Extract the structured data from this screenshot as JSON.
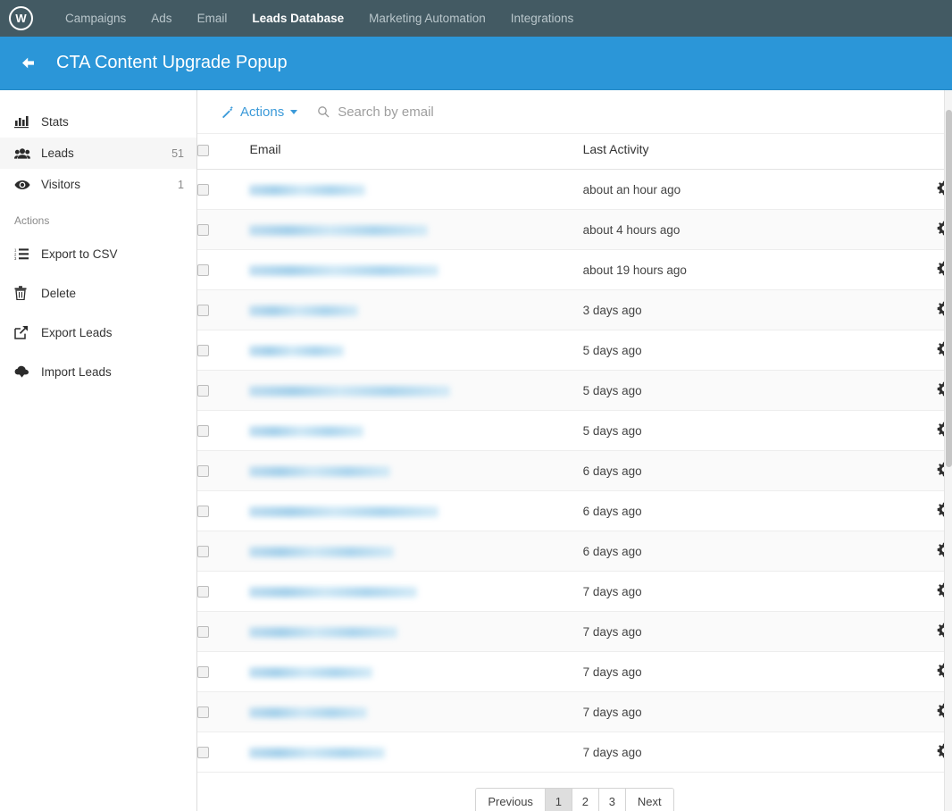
{
  "topnav": {
    "logo_text": "W",
    "items": [
      {
        "label": "Campaigns",
        "active": false
      },
      {
        "label": "Ads",
        "active": false
      },
      {
        "label": "Email",
        "active": false
      },
      {
        "label": "Leads Database",
        "active": true
      },
      {
        "label": "Marketing Automation",
        "active": false
      },
      {
        "label": "Integrations",
        "active": false
      }
    ]
  },
  "header": {
    "back_label": "back",
    "title": "CTA Content Upgrade Popup",
    "bg_color": "#2b96d8"
  },
  "sidebar": {
    "items": [
      {
        "label": "Stats",
        "count": "",
        "icon": "bar-chart-icon",
        "active": false
      },
      {
        "label": "Leads",
        "count": "51",
        "icon": "users-icon",
        "active": true
      },
      {
        "label": "Visitors",
        "count": "1",
        "icon": "eye-icon",
        "active": false
      }
    ],
    "section_label": "Actions",
    "actions": [
      {
        "label": "Export to CSV",
        "icon": "ordered-list-icon"
      },
      {
        "label": "Delete",
        "icon": "trash-icon"
      },
      {
        "label": "Export Leads",
        "icon": "external-link-icon"
      },
      {
        "label": "Import Leads",
        "icon": "cloud-download-icon"
      }
    ]
  },
  "toolbar": {
    "actions_label": "Actions",
    "actions_icon": "magic-wand-icon",
    "search_placeholder": "Search by email",
    "search_value": "",
    "search_icon": "search-icon"
  },
  "table": {
    "columns": [
      "Email",
      "Last Activity"
    ],
    "select_all_checked": false,
    "row_action_icon": "gear-icon",
    "rows": [
      {
        "email_redacted": true,
        "email_width": 130,
        "last_activity": "about an hour ago"
      },
      {
        "email_redacted": true,
        "email_width": 200,
        "last_activity": "about 4 hours ago"
      },
      {
        "email_redacted": true,
        "email_width": 212,
        "last_activity": "about 19 hours ago"
      },
      {
        "email_redacted": true,
        "email_width": 122,
        "last_activity": "3 days ago"
      },
      {
        "email_redacted": true,
        "email_width": 106,
        "last_activity": "5 days ago"
      },
      {
        "email_redacted": true,
        "email_width": 225,
        "last_activity": "5 days ago"
      },
      {
        "email_redacted": true,
        "email_width": 128,
        "last_activity": "5 days ago"
      },
      {
        "email_redacted": true,
        "email_width": 158,
        "last_activity": "6 days ago"
      },
      {
        "email_redacted": true,
        "email_width": 212,
        "last_activity": "6 days ago"
      },
      {
        "email_redacted": true,
        "email_width": 162,
        "last_activity": "6 days ago"
      },
      {
        "email_redacted": true,
        "email_width": 188,
        "last_activity": "7 days ago"
      },
      {
        "email_redacted": true,
        "email_width": 166,
        "last_activity": "7 days ago"
      },
      {
        "email_redacted": true,
        "email_width": 138,
        "last_activity": "7 days ago"
      },
      {
        "email_redacted": true,
        "email_width": 132,
        "last_activity": "7 days ago"
      },
      {
        "email_redacted": true,
        "email_width": 152,
        "last_activity": "7 days ago"
      }
    ]
  },
  "pagination": {
    "previous_label": "Previous",
    "pages": [
      "1",
      "2",
      "3"
    ],
    "active_page": "1",
    "next_label": "Next"
  }
}
